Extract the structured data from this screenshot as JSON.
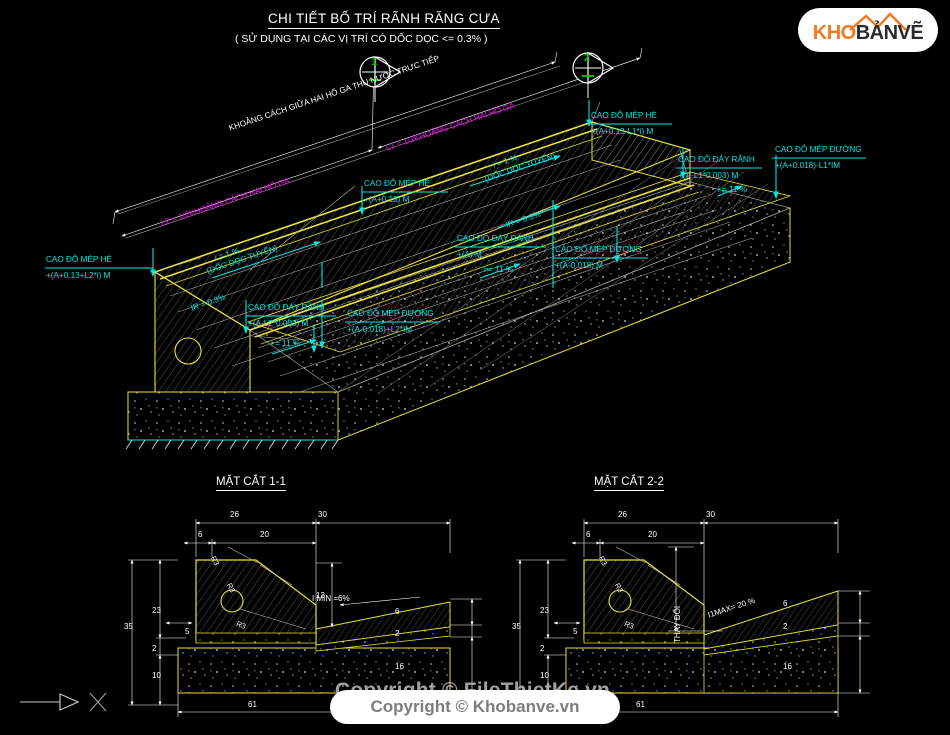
{
  "drawing": {
    "title": "CHI TIẾT BỐ TRÍ RÃNH RĂNG CƯA",
    "subtitle": "( SỬ DỤNG TẠI CÁC VỊ TRÍ CÓ DỐC DỌC <= 0.3% )"
  },
  "logo": {
    "part1": "KHO",
    "part2": "BẢNVẼ"
  },
  "section_markers": [
    {
      "id": "1",
      "label": "1"
    },
    {
      "id": "2",
      "label": "2"
    }
  ],
  "iso_labels": {
    "span_total": "KHOẢNG CÁCH GIỮA HAI HỐ GA THU NƯỚC TRỰC TIẾP",
    "span_left": "L2 = 1/2KHOẢNG CÁCH HAI HỐ GA",
    "span_right": "L1 = 1/2KHOẢNG CÁCH HAI HỐ GA",
    "slope_left_1": "i = 1 %",
    "slope_left_2": "(DỐC DỌC TUYẾN)",
    "slope_right_1": "i = 1 %",
    "slope_right_2": "(DỐC DỌC TUYẾN)",
    "slope_ir": "IR = 0.3%",
    "slope_ir2": "IR = 0.3%",
    "slope_11_left": "i = 11 %",
    "slope_11_mid": "i = 11 %",
    "slope_11_right": "i = 11 %"
  },
  "elevation_callouts": [
    {
      "name": "CAO ĐỘ MÉP HÈ",
      "value": "+(A+0.13+L2*i) M"
    },
    {
      "name": "CAO ĐỘ MÉP HÈ",
      "value": "+(A+0.13) M"
    },
    {
      "name": "CAO ĐỘ MÉP HÈ",
      "value": "+(A+0.13-L1*i) M"
    },
    {
      "name": "CAO ĐỘ ĐÁY RÃNH",
      "value": "+(A-L2*0.003) M"
    },
    {
      "name": "CAO ĐỘ ĐÁY RÃNH",
      "value": "+(A) M"
    },
    {
      "name": "CAO ĐỘ ĐÁY RÃNH",
      "value": "+(A-L1*0.003) M"
    },
    {
      "name": "CAO ĐỘ MÉP ĐƯỜNG",
      "value": "+(A-0.018)+L2*IM"
    },
    {
      "name": "CAO ĐỘ MÉP ĐƯỜNG",
      "value": "+(A-0.018) M"
    },
    {
      "name": "CAO ĐỘ MÉP ĐƯỜNG",
      "value": "+(A+0.018)-L1*IM"
    }
  ],
  "section_1": {
    "title": "MẶT CẮT 1-1",
    "dims": {
      "top_left": "26",
      "top_right": "30",
      "inner_left": "6",
      "inner_right": "20",
      "left_total": "35",
      "left_upper": "23",
      "left_lower": "10",
      "left_mid": "2",
      "kerb_step": "5",
      "right_drop": "13",
      "right_a": "6",
      "right_b": "2",
      "right_c": "16",
      "bottom": "61"
    },
    "radii": [
      "R3",
      "R3",
      "R3"
    ],
    "slope_note": "I MIN =6%"
  },
  "section_2": {
    "title": "MẶT CẮT 2-2",
    "dims": {
      "top_left": "26",
      "top_right": "30",
      "inner_left": "6",
      "inner_right": "20",
      "left_total": "35",
      "left_upper": "23",
      "left_lower": "10",
      "left_mid": "2",
      "kerb_step": "5",
      "right_a": "6",
      "right_b": "2",
      "right_c": "16",
      "bottom": "61"
    },
    "radii": [
      "R3",
      "R3",
      "R3"
    ],
    "vertical_note": "THAY ĐỔI",
    "slope_note": "I1MAX= 20 %"
  },
  "watermarks": {
    "back": "Copyright © FileThietKe.vn",
    "front": "Copyright © Khobanve.vn"
  },
  "colors": {
    "background": "#000000",
    "line_white": "#ffffff",
    "line_yellow": "#e8e03c",
    "text_cyan": "#00e5e5",
    "text_magenta": "#ff00ff",
    "text_green": "#00c000",
    "accent_orange": "#f47920"
  }
}
